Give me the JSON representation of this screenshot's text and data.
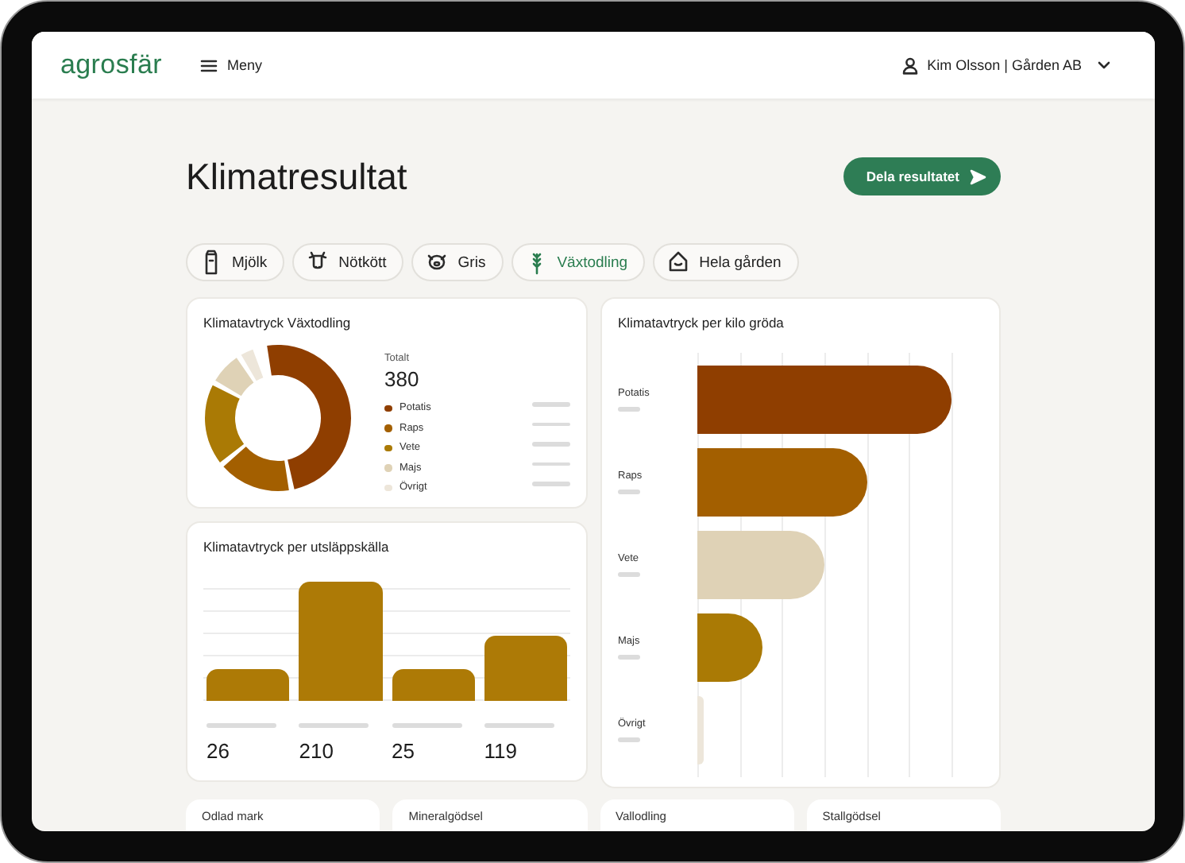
{
  "header": {
    "logo": "agrosfär",
    "menu_label": "Meny",
    "user": "Kim Olsson | Gården AB"
  },
  "title": "Klimatresultat",
  "share_button": "Dela resultatet",
  "tabs": [
    {
      "label": "Mjölk",
      "selected": false
    },
    {
      "label": "Nötkött",
      "selected": false
    },
    {
      "label": "Gris",
      "selected": false
    },
    {
      "label": "Växtodling",
      "selected": true
    },
    {
      "label": "Hela gården",
      "selected": false
    }
  ],
  "donut_card": {
    "title": "Klimatavtryck Växtodling",
    "total_label": "Totalt",
    "total": "380",
    "legend": [
      {
        "label": "Potatis",
        "color": "#8f3e00"
      },
      {
        "label": "Raps",
        "color": "#a35f00"
      },
      {
        "label": "Vete",
        "color": "#aa7a05"
      },
      {
        "label": "Majs",
        "color": "#dfd2b6"
      },
      {
        "label": "Övrigt",
        "color": "#ede6da"
      }
    ]
  },
  "source_card": {
    "title": "Klimatavtryck per utsläppskälla",
    "values": [
      "26",
      "210",
      "25",
      "119"
    ]
  },
  "kilo_card": {
    "title": "Klimatavtryck per kilo gröda",
    "rows": [
      {
        "label": "Potatis",
        "color": "#8f3e00"
      },
      {
        "label": "Raps",
        "color": "#a35f00"
      },
      {
        "label": "Vete",
        "color": "#dfd2b6"
      },
      {
        "label": "Majs",
        "color": "#aa7a05"
      },
      {
        "label": "Övrigt",
        "color": "#ede6da"
      }
    ]
  },
  "bottom_cards": [
    "Odlad mark",
    "Mineralgödsel",
    "Vallodling",
    "Stallgödsel"
  ]
}
